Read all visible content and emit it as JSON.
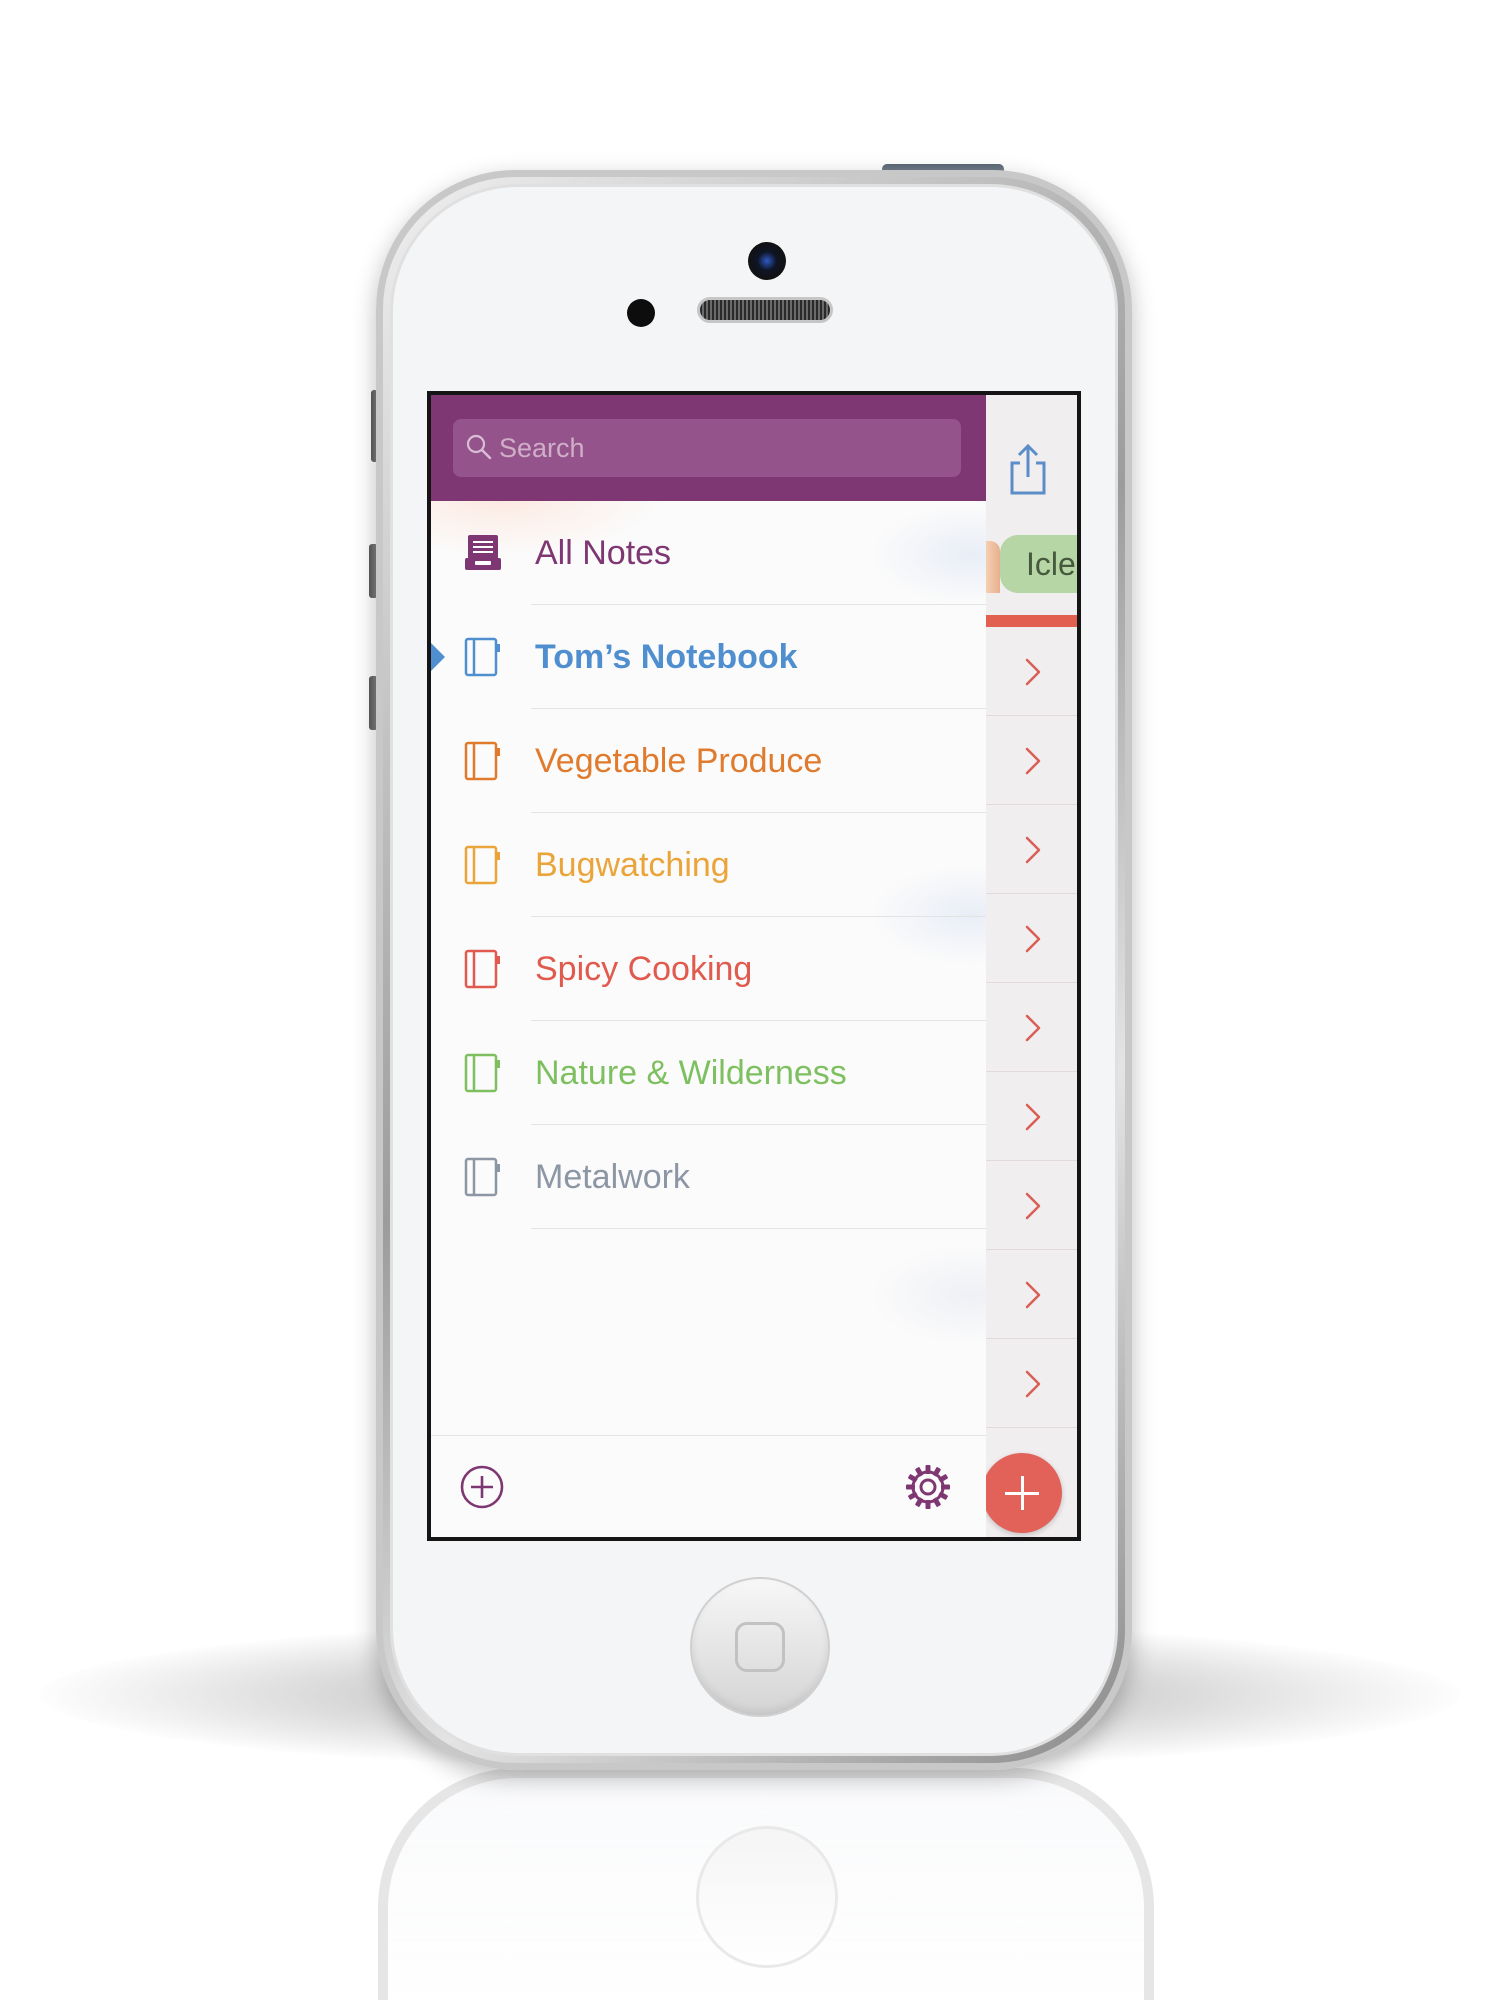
{
  "sidebar": {
    "search": {
      "placeholder": "Search"
    },
    "items": [
      {
        "label": "All Notes",
        "color": "#7e3773",
        "icon": "all-notes-icon",
        "selected": false
      },
      {
        "label": "Tom’s Notebook",
        "color": "#4f8fcf",
        "icon": "notebook-icon",
        "selected": true
      },
      {
        "label": "Vegetable Produce",
        "color": "#e07b2e",
        "icon": "notebook-icon",
        "selected": false
      },
      {
        "label": "Bugwatching",
        "color": "#eba43a",
        "icon": "notebook-icon",
        "selected": false
      },
      {
        "label": "Spicy Cooking",
        "color": "#e15a4e",
        "icon": "notebook-icon",
        "selected": false
      },
      {
        "label": "Nature & Wilderness",
        "color": "#7ec060",
        "icon": "notebook-icon",
        "selected": false
      },
      {
        "label": "Metalwork",
        "color": "#8c96a4",
        "icon": "notebook-icon",
        "selected": false
      }
    ],
    "footer": {
      "add_icon": "add-circle-icon",
      "settings_icon": "gear-icon"
    }
  },
  "main_pane": {
    "share_icon": "share-icon",
    "tag_label": "Icle",
    "row_count": 9,
    "row_chevron_icon": "chevron-right-icon",
    "fab_icon": "plus-icon"
  },
  "colors": {
    "header_purple": "#7e3773",
    "search_field": "#94538b",
    "accent_red": "#e2625a",
    "tag_green": "#b6d6a5",
    "share_blue": "#5b8dc9"
  }
}
